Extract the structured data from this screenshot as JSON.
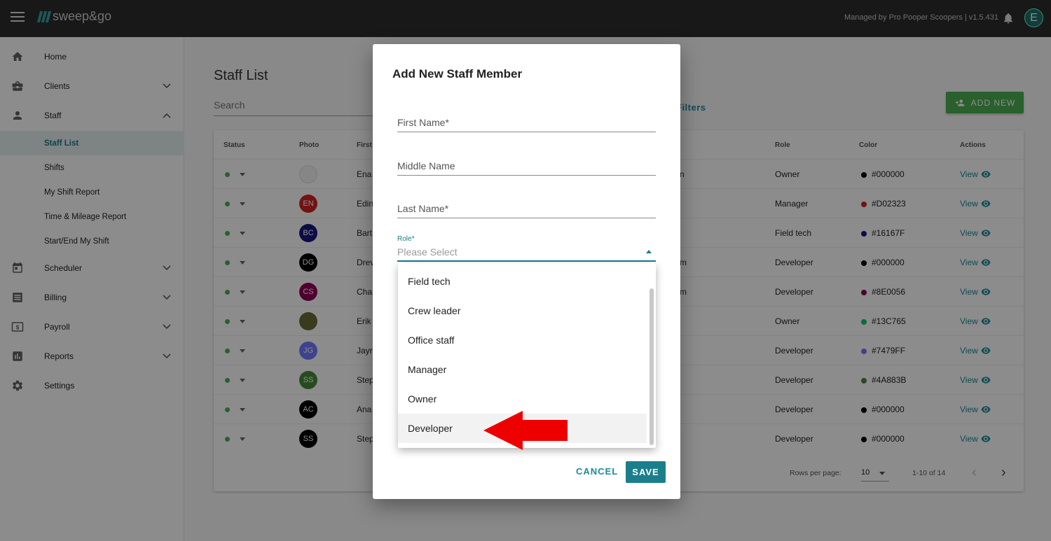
{
  "topbar": {
    "logo_text": "sweep&go",
    "managed_text": "Managed by Pro Pooper Scoopers | v1.5.431",
    "avatar_letter": "E"
  },
  "sidebar": {
    "items": [
      {
        "label": "Home",
        "icon": "home-icon"
      },
      {
        "label": "Clients",
        "icon": "briefcase-icon"
      },
      {
        "label": "Staff",
        "icon": "person-icon"
      },
      {
        "label": "Scheduler",
        "icon": "calendar-icon"
      },
      {
        "label": "Billing",
        "icon": "billing-icon"
      },
      {
        "label": "Payroll",
        "icon": "dollar-icon"
      },
      {
        "label": "Reports",
        "icon": "chart-icon"
      },
      {
        "label": "Settings",
        "icon": "gear-icon"
      }
    ],
    "staff_sub": [
      "Staff List",
      "Shifts",
      "My Shift Report",
      "Time & Mileage Report",
      "Start/End My Shift"
    ]
  },
  "main": {
    "title": "Staff List",
    "search_placeholder": "Search",
    "filters_label": "Filters",
    "add_new_label": "ADD NEW"
  },
  "table": {
    "headers": {
      "status": "Status",
      "photo": "Photo",
      "first": "First",
      "role": "Role",
      "color": "Color",
      "actions": "Actions"
    },
    "view_label": "View",
    "rows": [
      {
        "initials": "",
        "photo_color": "#f5f5f5",
        "first": "Ena",
        "extra": "n",
        "role": "Owner",
        "color_hex": "#000000",
        "color_label": "#000000"
      },
      {
        "initials": "EN",
        "photo_color": "#D02323",
        "first": "Edin",
        "extra": "",
        "role": "Manager",
        "color_hex": "#D02323",
        "color_label": "#D02323"
      },
      {
        "initials": "BC",
        "photo_color": "#16167F",
        "first": "Bart",
        "extra": "",
        "role": "Field tech",
        "color_hex": "#16167F",
        "color_label": "#16167F"
      },
      {
        "initials": "DG",
        "photo_color": "#000000",
        "first": "Drev",
        "extra": "m",
        "role": "Developer",
        "color_hex": "#000000",
        "color_label": "#000000"
      },
      {
        "initials": "CS",
        "photo_color": "#8E0056",
        "first": "Char",
        "extra": "m",
        "role": "Developer",
        "color_hex": "#8E0056",
        "color_label": "#8E0056"
      },
      {
        "initials": "",
        "photo_color": "#6b6b3a",
        "first": "Erik",
        "extra": "",
        "role": "Owner",
        "color_hex": "#13C765",
        "color_label": "#13C765"
      },
      {
        "initials": "JG",
        "photo_color": "#7479FF",
        "first": "Jayr",
        "extra": "",
        "role": "Developer",
        "color_hex": "#7479FF",
        "color_label": "#7479FF"
      },
      {
        "initials": "SS",
        "photo_color": "#4A883B",
        "first": "Step",
        "extra": "",
        "role": "Developer",
        "color_hex": "#4A883B",
        "color_label": "#4A883B"
      },
      {
        "initials": "AC",
        "photo_color": "#000000",
        "first": "Ana",
        "extra": "",
        "role": "Developer",
        "color_hex": "#000000",
        "color_label": "#000000"
      },
      {
        "initials": "SS",
        "photo_color": "#000000",
        "first": "Step",
        "extra": "",
        "role": "Developer",
        "color_hex": "#000000",
        "color_label": "#000000"
      }
    ],
    "footer": {
      "rows_per_page_label": "Rows per page:",
      "rows_per_page": "10",
      "range": "1-10 of 14"
    }
  },
  "dialog": {
    "title": "Add New Staff Member",
    "first_name": "First Name*",
    "middle_name": "Middle Name",
    "last_name": "Last Name*",
    "role_label": "Role*",
    "role_placeholder": "Please Select",
    "cancel": "CANCEL",
    "save": "SAVE"
  },
  "role_options": [
    "Field tech",
    "Crew leader",
    "Office staff",
    "Manager",
    "Owner",
    "Developer"
  ],
  "highlighted_option": "Developer"
}
